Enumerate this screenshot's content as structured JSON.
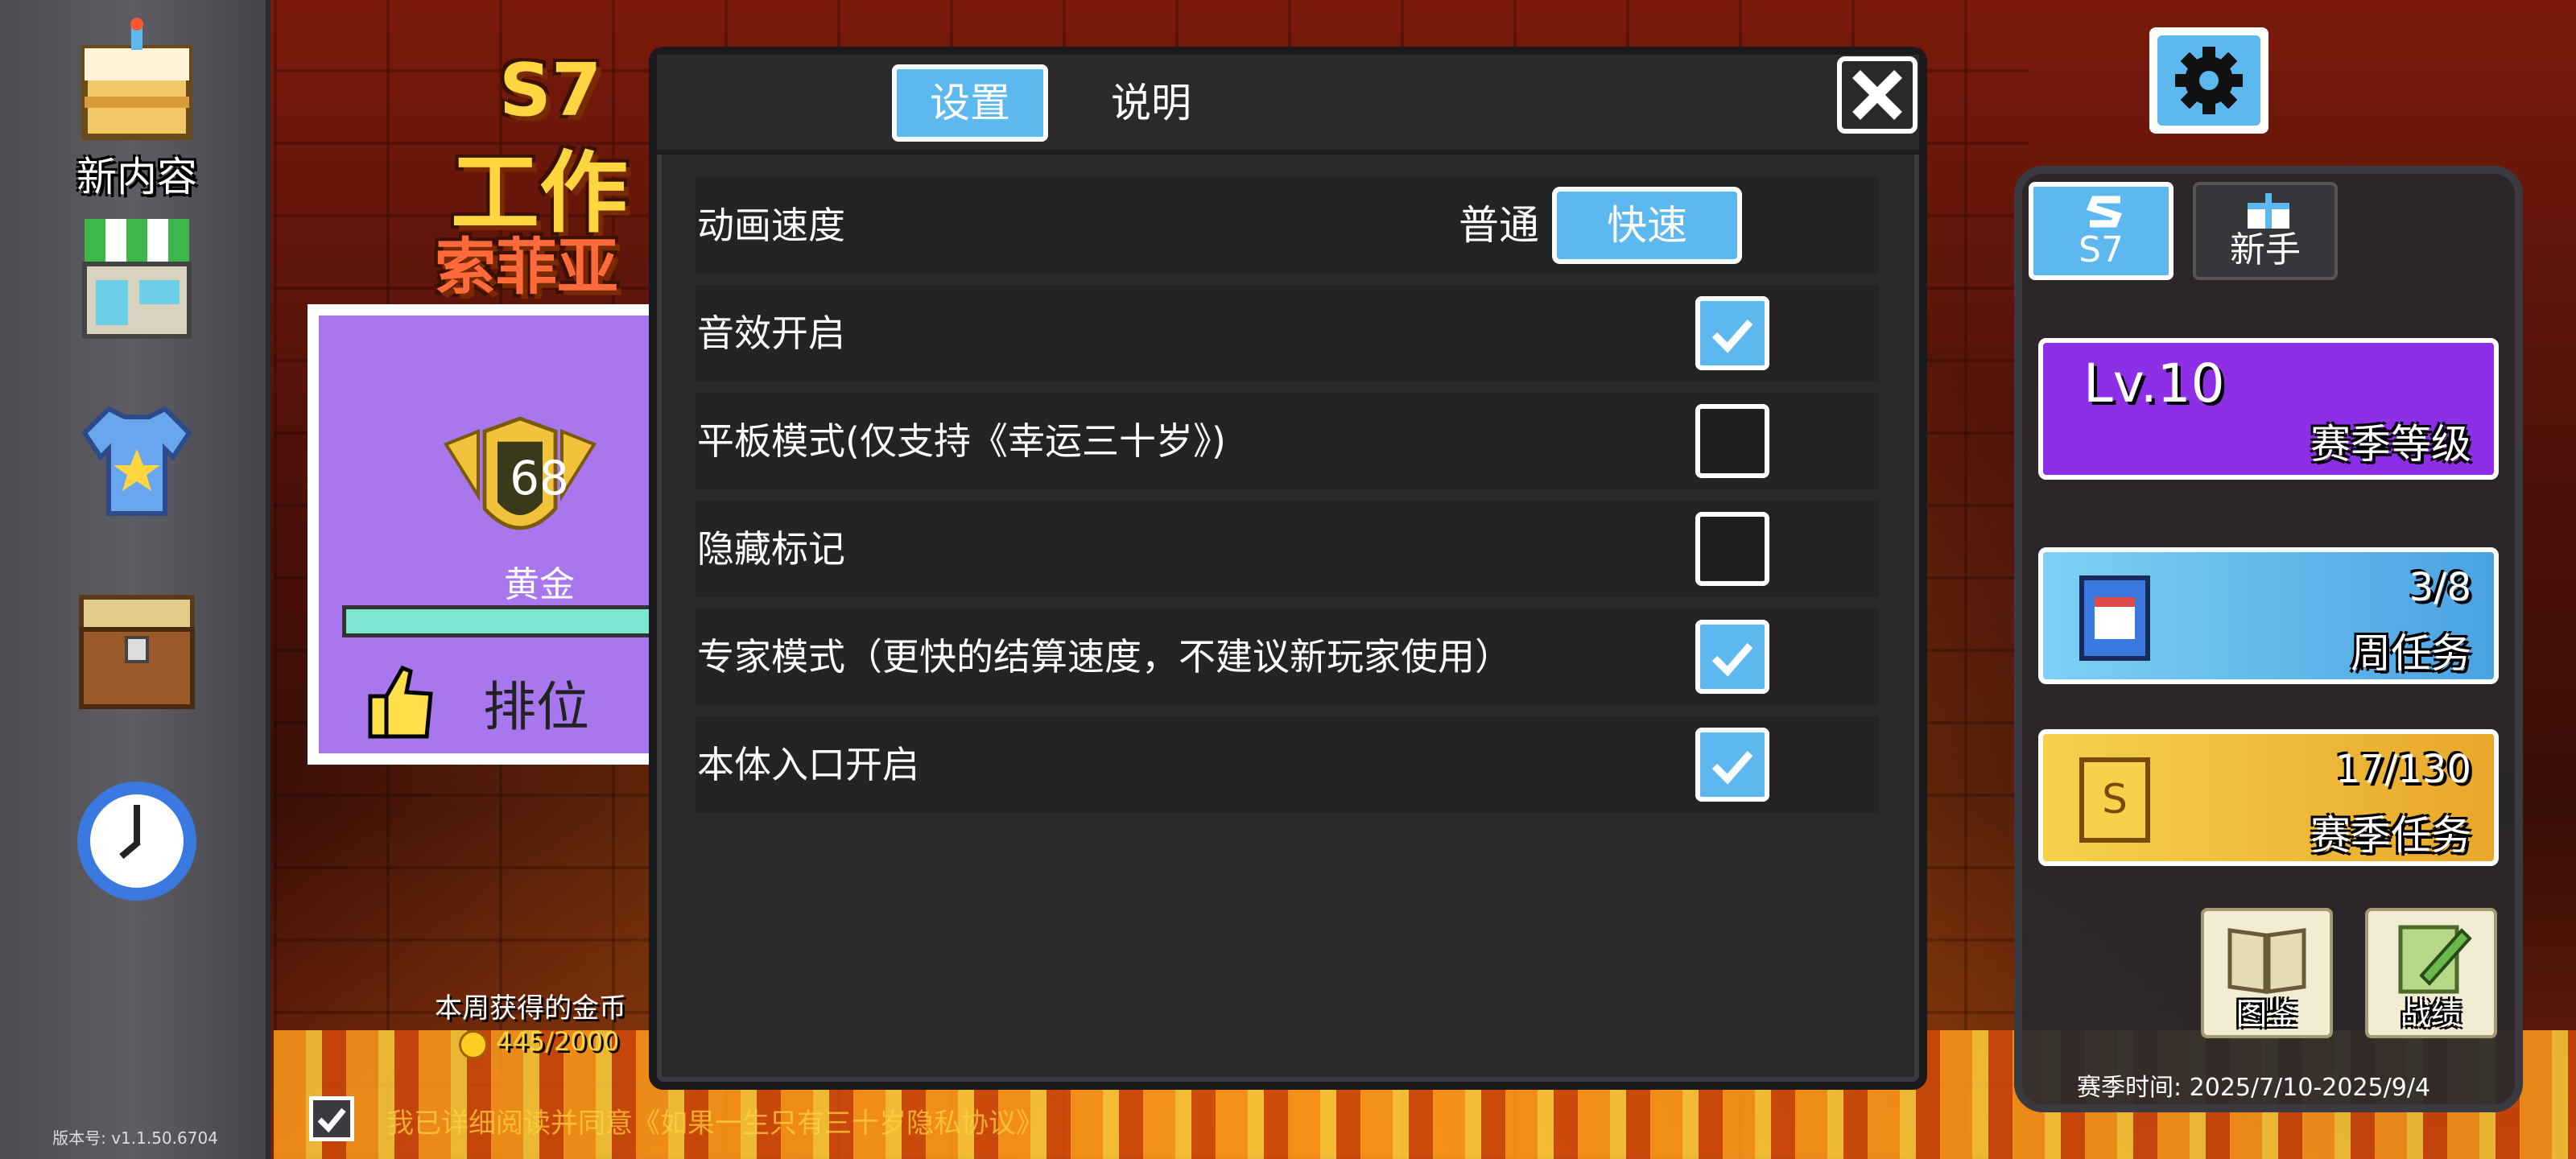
{
  "sidebar": {
    "items": [
      {
        "label": "新内容",
        "icon": "cake-icon"
      },
      {
        "label": "",
        "icon": "shop-icon"
      },
      {
        "label": "",
        "icon": "tshirt-icon"
      },
      {
        "label": "",
        "icon": "chest-icon"
      },
      {
        "label": "",
        "icon": "clock-icon"
      }
    ],
    "version": "版本号: v1.1.50.6704"
  },
  "event": {
    "season": "S7",
    "title_line1": "工作",
    "title_line2": "索菲亚",
    "rank_number": "68",
    "rank_tier": "黄金",
    "rank_label": "排位",
    "coins_label": "本周获得的金币",
    "coins_value": "445/2000",
    "agreement_text": "我已详细阅读并同意《如果一生只有三十岁隐私协议》"
  },
  "modal": {
    "tabs": [
      {
        "label": "设置",
        "active": true
      },
      {
        "label": "说明",
        "active": false
      }
    ],
    "rows": [
      {
        "label": "动画速度",
        "type": "segmented",
        "options": [
          "普通",
          "快速"
        ],
        "selected": "快速"
      },
      {
        "label": "音效开启",
        "type": "checkbox",
        "checked": true
      },
      {
        "label": "平板模式(仅支持《幸运三十岁》)",
        "type": "checkbox",
        "checked": false
      },
      {
        "label": "隐藏标记",
        "type": "checkbox",
        "checked": false
      },
      {
        "label": "专家模式（更快的结算速度，不建议新玩家使用）",
        "type": "checkbox",
        "checked": true
      },
      {
        "label": "本体入口开启",
        "type": "checkbox",
        "checked": true
      }
    ]
  },
  "right": {
    "tabs": [
      {
        "label": "S7",
        "active": true
      },
      {
        "label": "新手",
        "active": false
      }
    ],
    "level_card": {
      "level": "Lv.10",
      "title": "赛季等级"
    },
    "weekly_card": {
      "progress": "3/8",
      "title": "周任务"
    },
    "season_card": {
      "progress": "17/130",
      "title": "赛季任务"
    },
    "buttons": [
      {
        "label": "图鉴"
      },
      {
        "label": "战绩"
      }
    ],
    "season_time": "赛季时间: 2025/7/10-2025/9/4"
  },
  "colors": {
    "accent_blue": "#5cb8ee",
    "modal_bg": "#2a2a2c",
    "level_purple": "#8e2fe8",
    "season_gold": "#f5d24a"
  }
}
